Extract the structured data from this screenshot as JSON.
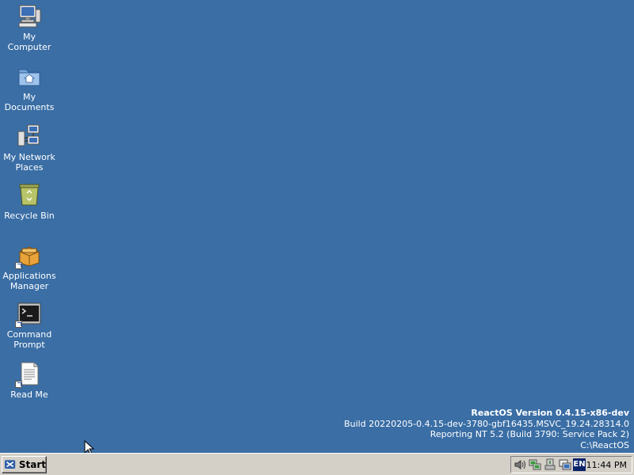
{
  "desktop": {
    "icons": [
      {
        "label": "My Computer",
        "icon": "my-computer-icon"
      },
      {
        "label": "My Documents",
        "icon": "my-documents-icon"
      },
      {
        "label": "My Network Places",
        "icon": "network-places-icon"
      },
      {
        "label": "Recycle Bin",
        "icon": "recycle-bin-icon"
      },
      {
        "label": "Applications Manager",
        "icon": "applications-manager-icon"
      },
      {
        "label": "Command Prompt",
        "icon": "command-prompt-icon"
      },
      {
        "label": "Read Me",
        "icon": "read-me-icon"
      }
    ],
    "background_color": "#3a6ea5"
  },
  "version_info": {
    "title": "ReactOS Version 0.4.15-x86-dev",
    "build": "Build 20220205-0.4.15-dev-3780-gbf16435.MSVC_19.24.28314.0",
    "reporting": "Reporting NT 5.2 (Build 3790: Service Pack 2)",
    "path": "C:\\ReactOS"
  },
  "taskbar": {
    "start_label": "Start",
    "tray": {
      "icons": [
        "volume-icon",
        "network-icon",
        "safely-remove-icon",
        "display-icon"
      ],
      "language": "EN",
      "clock": "11:44 PM"
    }
  }
}
